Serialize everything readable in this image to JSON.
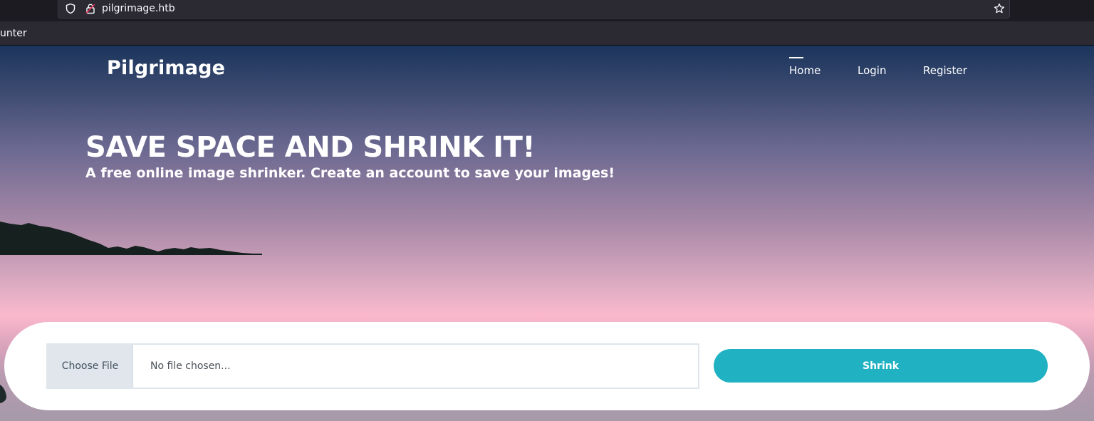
{
  "browser": {
    "url": "pilgrimage.htb",
    "bookmark_label": "unter"
  },
  "site": {
    "brand": "Pilgrimage",
    "nav": {
      "home": "Home",
      "login": "Login",
      "register": "Register"
    }
  },
  "hero": {
    "title": "SAVE SPACE AND SHRINK IT!",
    "subtitle": "A free online image shrinker. Create an account to save your images!"
  },
  "upload": {
    "choose_file_label": "Choose File",
    "file_status": "No file chosen...",
    "submit_label": "Shrink"
  },
  "colors": {
    "accent": "#20b2c2",
    "text_light": "#ffffff"
  }
}
